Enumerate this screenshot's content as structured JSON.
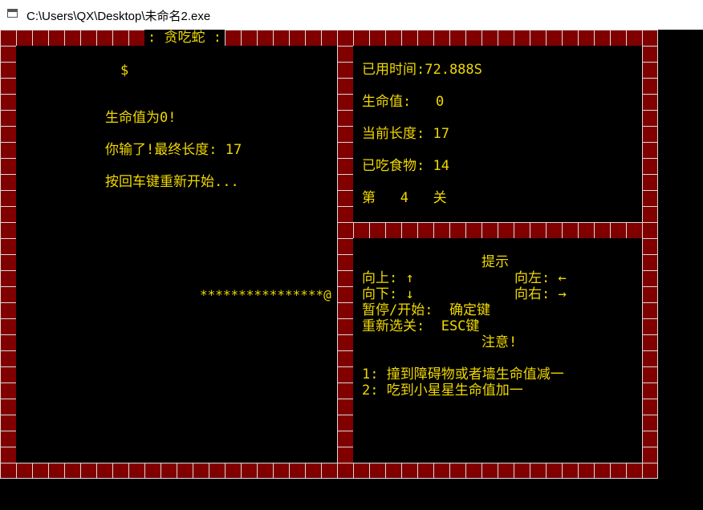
{
  "window": {
    "title": "C:\\Users\\QX\\Desktop\\未命名2.exe"
  },
  "game": {
    "title": ": 贪吃蛇 :",
    "food": "$",
    "snake": "****************@",
    "messages": {
      "life_zero": "生命值为0!",
      "game_over": "你输了!最终长度: 17",
      "restart": "按回车键重新开始..."
    }
  },
  "stats": {
    "time": "已用时间:72.888S",
    "life": "生命值:   0",
    "length": "当前长度: 17",
    "eaten": "已吃食物: 14",
    "level": "第   4   关"
  },
  "tips": {
    "header": "提示",
    "up": "向上: ↑",
    "left": "向左: ←",
    "down": "向下: ↓",
    "right": "向右: →",
    "pause": "暂停/开始:  确定键",
    "select": "重新选关:  ESC键",
    "note": "注意!",
    "rule1": "1: 撞到障碍物或者墙生命值减一",
    "rule2": "2: 吃到小星星生命值加一"
  },
  "colors": {
    "wall": "#800000",
    "grid": "#d9d9d9",
    "text": "#f0d800"
  }
}
